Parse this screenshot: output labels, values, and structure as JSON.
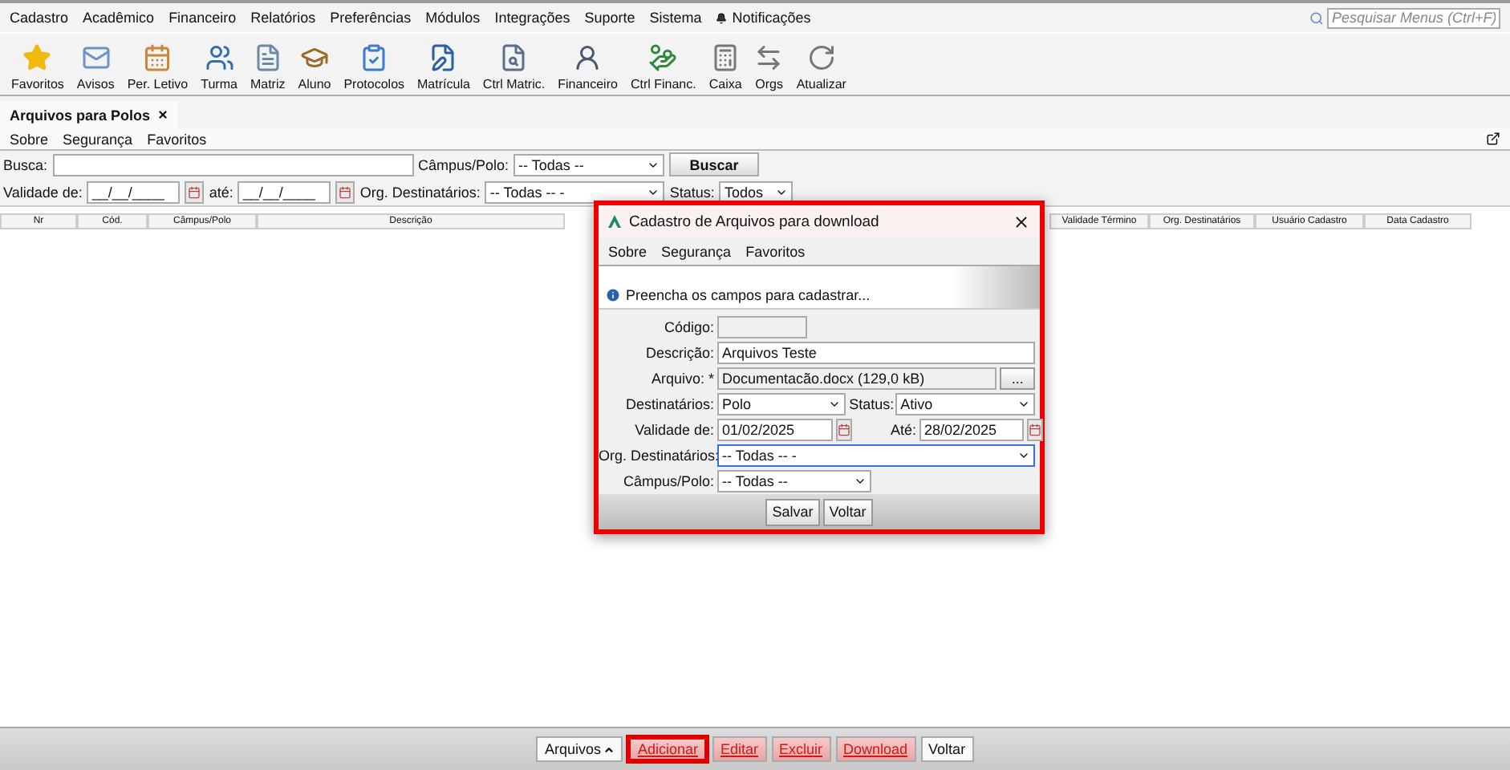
{
  "menu_bar": {
    "items": [
      "Cadastro",
      "Acadêmico",
      "Financeiro",
      "Relatórios",
      "Preferências",
      "Módulos",
      "Integrações",
      "Suporte",
      "Sistema"
    ],
    "notifications": "Notificações",
    "search": {
      "placeholder": "Pesquisar Menus (Ctrl+F)"
    }
  },
  "toolbar": [
    "Favoritos",
    "Avisos",
    "Per. Letivo",
    "Turma",
    "Matriz",
    "Aluno",
    "Protocolos",
    "Matrícula",
    "Ctrl Matric.",
    "Financeiro",
    "Ctrl Financ.",
    "Caixa",
    "Orgs",
    "Atualizar"
  ],
  "tabs": [
    {
      "label": "Arquivos para Polos",
      "selected": true
    }
  ],
  "sub_menu": [
    "Sobre",
    "Segurança",
    "Favoritos"
  ],
  "filters": {
    "search_label": "Busca:",
    "campus_label": "Câmpus/Polo:",
    "campus_value": "-- Todas --",
    "search_button": "Buscar",
    "valid_from_label": "Validade de:",
    "valid_from_value": "__/__/____",
    "valid_to_label": "até:",
    "valid_to_value": "__/__/____",
    "org_label": "Org. Destinatários:",
    "org_value": "-- Todas -- -",
    "status_label": "Status:",
    "status_value": "Todos"
  },
  "table": {
    "columns_left": [
      "Nr",
      "Cód.",
      "Câmpus/Polo",
      "Descrição"
    ],
    "columns_right": [
      "Validade Término",
      "Org. Destinatários",
      "Usuário Cadastro",
      "Data Cadastro"
    ]
  },
  "dialog": {
    "title": "Cadastro de Arquivos para download",
    "highlighted": true,
    "menu": [
      "Sobre",
      "Segurança",
      "Favoritos"
    ],
    "info": "Preencha os campos para cadastrar...",
    "fields": {
      "code": {
        "label": "Código:"
      },
      "description": {
        "label": "Descrição:",
        "value": "Arquivos Teste"
      },
      "file": {
        "label": "Arquivo: *",
        "value": "Documentacão.docx (129,0 kB)",
        "button": "..."
      },
      "recipients": {
        "label": "Destinatários:",
        "value": "Polo"
      },
      "status": {
        "label": "Status:",
        "value": "Ativo"
      },
      "valid_from": {
        "label": "Validade de:",
        "value": "01/02/2025"
      },
      "valid_to": {
        "label": "Até:",
        "value": "28/02/2025"
      },
      "org_recipients": {
        "label": "Org. Destinatários:",
        "value": "-- Todas -- -",
        "focused": true
      },
      "campus": {
        "label": "Câmpus/Polo:",
        "value": "-- Todas --",
        "focused": false
      }
    },
    "buttons": [
      "Salvar",
      "Voltar"
    ]
  },
  "bottom_buttons": [
    {
      "label": "Arquivos",
      "kind": "menu",
      "highlighted": false
    },
    {
      "label": "Adicionar",
      "kind": "danger",
      "highlighted": true
    },
    {
      "label": "Editar",
      "kind": "danger",
      "highlighted": false
    },
    {
      "label": "Excluir",
      "kind": "danger",
      "highlighted": false
    },
    {
      "label": "Download",
      "kind": "danger",
      "highlighted": false
    },
    {
      "label": "Voltar",
      "kind": "normal",
      "highlighted": false
    }
  ]
}
